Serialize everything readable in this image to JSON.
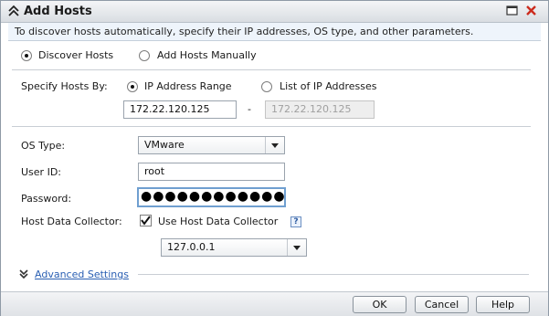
{
  "dialog": {
    "title": "Add Hosts",
    "info_text": "To discover hosts automatically, specify their IP addresses, OS type, and other parameters."
  },
  "mode": {
    "discover_label": "Discover Hosts",
    "manual_label": "Add Hosts Manually",
    "selected": "Discover Hosts"
  },
  "specify": {
    "label": "Specify Hosts By:",
    "ip_range_label": "IP Address Range",
    "list_label": "List of IP Addresses",
    "selected": "IP Address Range",
    "range_start": "172.22.120.125",
    "range_separator": "-",
    "range_end": "172.22.120.125"
  },
  "os_type": {
    "label": "OS Type:",
    "value": "VMware"
  },
  "user_id": {
    "label": "User ID:",
    "value": "root"
  },
  "password": {
    "label": "Password:",
    "masked": "●●●●●●●●●●●●"
  },
  "collector": {
    "label": "Host Data Collector:",
    "checkbox_label": "Use Host Data Collector",
    "checked": true,
    "help_glyph": "?",
    "address": "127.0.0.1"
  },
  "advanced": {
    "link_text": "Advanced Settings"
  },
  "footer": {
    "ok_label": "OK",
    "cancel_label": "Cancel",
    "help_label": "Help"
  },
  "icons": {
    "collapse": "double-chevron-up-icon",
    "restore": "restore-window-icon",
    "close": "close-icon",
    "expand": "double-chevron-down-icon",
    "help": "help-icon",
    "checkmark": "checkmark-icon"
  },
  "colors": {
    "close_x": "#cc2b1d",
    "link": "#2a5fb3",
    "focus_border": "#6f9fd0",
    "info_bg": "#eef4fb"
  }
}
